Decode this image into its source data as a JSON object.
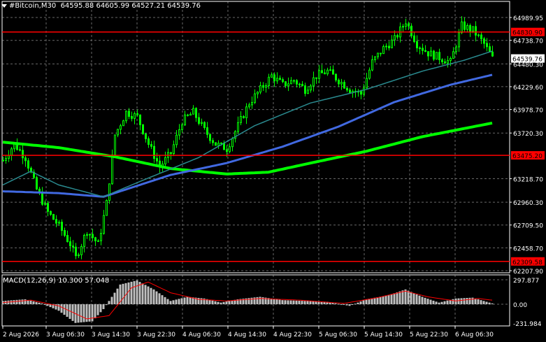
{
  "header": {
    "symbol_tf": "#Bitcoin,M30",
    "ohlc": "64595.88 64605.99 64527.21 64539.76"
  },
  "macd_label": "MACD(12,26,9) 10.300 57.048",
  "colors": {
    "background": "#000000",
    "grid": "#c0c0c0",
    "candle": "#00ff00",
    "ma_fast": "#1e90ff",
    "ma_teal": "#2a8a8f",
    "ma_slow": "#4169e1",
    "ma_long": "#00ff00",
    "hline": "#ff0000",
    "macd_hist": "#c0c0c0",
    "macd_signal": "#ff0000"
  },
  "price_axis": {
    "labels": [
      "64989.95",
      "64738.70",
      "64480.30",
      "64229.60",
      "63978.70",
      "63720.30",
      "63218.70",
      "62960.30",
      "62709.50",
      "62458.70",
      "62207.90"
    ],
    "current_price": "64539.76",
    "hlines": [
      {
        "price": 64830.9,
        "label": "64830.90"
      },
      {
        "price": 63475.2,
        "label": "63475.20"
      },
      {
        "price": 62309.58,
        "label": "62309.58"
      }
    ]
  },
  "macd_axis": {
    "labels": [
      "297.877",
      "0.00",
      "-231.984"
    ]
  },
  "time_axis": {
    "labels": [
      "2 Aug 2026",
      "3 Aug 06:30",
      "3 Aug 14:30",
      "3 Aug 22:30",
      "4 Aug 06:30",
      "4 Aug 14:30",
      "4 Aug 22:30",
      "5 Aug 06:30",
      "5 Aug 14:30",
      "5 Aug 22:30",
      "6 Aug 06:30"
    ]
  },
  "chart_data": {
    "type": "candlestick",
    "symbol": "#Bitcoin",
    "timeframe": "M30",
    "ylim": [
      62207.9,
      65060
    ],
    "close_path": [
      {
        "t": 0,
        "p": 63420
      },
      {
        "t": 4,
        "p": 63600
      },
      {
        "t": 8,
        "p": 63450
      },
      {
        "t": 12,
        "p": 63100
      },
      {
        "t": 16,
        "p": 62850
      },
      {
        "t": 20,
        "p": 62700
      },
      {
        "t": 24,
        "p": 62500
      },
      {
        "t": 26,
        "p": 62350
      },
      {
        "t": 30,
        "p": 62650
      },
      {
        "t": 34,
        "p": 62500
      },
      {
        "t": 37,
        "p": 62950
      },
      {
        "t": 40,
        "p": 63700
      },
      {
        "t": 44,
        "p": 63950
      },
      {
        "t": 48,
        "p": 63900
      },
      {
        "t": 52,
        "p": 63600
      },
      {
        "t": 56,
        "p": 63350
      },
      {
        "t": 60,
        "p": 63500
      },
      {
        "t": 64,
        "p": 63850
      },
      {
        "t": 68,
        "p": 63950
      },
      {
        "t": 72,
        "p": 63750
      },
      {
        "t": 76,
        "p": 63600
      },
      {
        "t": 80,
        "p": 63550
      },
      {
        "t": 84,
        "p": 63800
      },
      {
        "t": 88,
        "p": 64050
      },
      {
        "t": 92,
        "p": 64200
      },
      {
        "t": 96,
        "p": 64350
      },
      {
        "t": 100,
        "p": 64250
      },
      {
        "t": 104,
        "p": 64300
      },
      {
        "t": 108,
        "p": 64200
      },
      {
        "t": 112,
        "p": 64350
      },
      {
        "t": 116,
        "p": 64400
      },
      {
        "t": 120,
        "p": 64300
      },
      {
        "t": 124,
        "p": 64200
      },
      {
        "t": 128,
        "p": 64150
      },
      {
        "t": 132,
        "p": 64500
      },
      {
        "t": 136,
        "p": 64650
      },
      {
        "t": 140,
        "p": 64750
      },
      {
        "t": 144,
        "p": 64950
      },
      {
        "t": 148,
        "p": 64700
      },
      {
        "t": 152,
        "p": 64600
      },
      {
        "t": 156,
        "p": 64550
      },
      {
        "t": 160,
        "p": 64500
      },
      {
        "t": 164,
        "p": 64900
      },
      {
        "t": 168,
        "p": 64850
      },
      {
        "t": 172,
        "p": 64700
      },
      {
        "t": 175,
        "p": 64540
      }
    ],
    "ma_teal_path": [
      {
        "t": 0,
        "p": 63150
      },
      {
        "t": 10,
        "p": 63300
      },
      {
        "t": 20,
        "p": 63150
      },
      {
        "t": 36,
        "p": 63020
      },
      {
        "t": 50,
        "p": 63200
      },
      {
        "t": 70,
        "p": 63450
      },
      {
        "t": 90,
        "p": 63800
      },
      {
        "t": 110,
        "p": 64050
      },
      {
        "t": 130,
        "p": 64200
      },
      {
        "t": 150,
        "p": 64400
      },
      {
        "t": 165,
        "p": 64520
      },
      {
        "t": 175,
        "p": 64620
      }
    ],
    "ma_blue_path": [
      {
        "t": 0,
        "p": 63080
      },
      {
        "t": 20,
        "p": 63060
      },
      {
        "t": 36,
        "p": 63020
      },
      {
        "t": 60,
        "p": 63260
      },
      {
        "t": 80,
        "p": 63390
      },
      {
        "t": 100,
        "p": 63570
      },
      {
        "t": 120,
        "p": 63790
      },
      {
        "t": 140,
        "p": 64060
      },
      {
        "t": 160,
        "p": 64250
      },
      {
        "t": 175,
        "p": 64360
      }
    ],
    "ma_green_path": [
      {
        "t": 0,
        "p": 63620
      },
      {
        "t": 20,
        "p": 63560
      },
      {
        "t": 40,
        "p": 63460
      },
      {
        "t": 60,
        "p": 63330
      },
      {
        "t": 80,
        "p": 63270
      },
      {
        "t": 95,
        "p": 63290
      },
      {
        "t": 110,
        "p": 63390
      },
      {
        "t": 130,
        "p": 63520
      },
      {
        "t": 150,
        "p": 63680
      },
      {
        "t": 175,
        "p": 63830
      }
    ],
    "macd_hist": [
      {
        "t": 0,
        "v": 40
      },
      {
        "t": 8,
        "v": 60
      },
      {
        "t": 14,
        "v": 10
      },
      {
        "t": 20,
        "v": -80
      },
      {
        "t": 26,
        "v": -230
      },
      {
        "t": 32,
        "v": -210
      },
      {
        "t": 36,
        "v": -60
      },
      {
        "t": 42,
        "v": 240
      },
      {
        "t": 48,
        "v": 290
      },
      {
        "t": 54,
        "v": 180
      },
      {
        "t": 60,
        "v": 40
      },
      {
        "t": 66,
        "v": 90
      },
      {
        "t": 72,
        "v": 70
      },
      {
        "t": 78,
        "v": 20
      },
      {
        "t": 84,
        "v": 60
      },
      {
        "t": 92,
        "v": 90
      },
      {
        "t": 100,
        "v": 50
      },
      {
        "t": 108,
        "v": 40
      },
      {
        "t": 116,
        "v": 30
      },
      {
        "t": 124,
        "v": -20
      },
      {
        "t": 130,
        "v": 60
      },
      {
        "t": 138,
        "v": 110
      },
      {
        "t": 144,
        "v": 180
      },
      {
        "t": 150,
        "v": 90
      },
      {
        "t": 156,
        "v": 20
      },
      {
        "t": 162,
        "v": 70
      },
      {
        "t": 168,
        "v": 80
      },
      {
        "t": 175,
        "v": 10
      }
    ],
    "macd_signal": [
      {
        "t": 0,
        "v": 20
      },
      {
        "t": 10,
        "v": 50
      },
      {
        "t": 20,
        "v": -20
      },
      {
        "t": 30,
        "v": -180
      },
      {
        "t": 38,
        "v": -140
      },
      {
        "t": 46,
        "v": 200
      },
      {
        "t": 52,
        "v": 270
      },
      {
        "t": 60,
        "v": 140
      },
      {
        "t": 70,
        "v": 60
      },
      {
        "t": 80,
        "v": 40
      },
      {
        "t": 92,
        "v": 70
      },
      {
        "t": 106,
        "v": 50
      },
      {
        "t": 122,
        "v": 10
      },
      {
        "t": 134,
        "v": 80
      },
      {
        "t": 144,
        "v": 160
      },
      {
        "t": 152,
        "v": 90
      },
      {
        "t": 162,
        "v": 40
      },
      {
        "t": 170,
        "v": 70
      },
      {
        "t": 175,
        "v": 50
      }
    ],
    "macd_ylim": [
      -231.984,
      297.877
    ]
  }
}
